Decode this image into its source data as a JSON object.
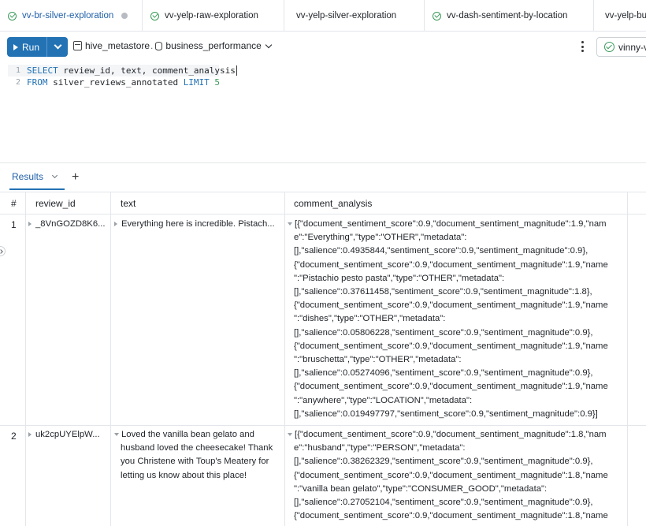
{
  "tabs": [
    {
      "label": "vv-br-silver-exploration",
      "active": true,
      "status": "check",
      "unsaved": true
    },
    {
      "label": "vv-yelp-raw-exploration",
      "active": false,
      "status": "check"
    },
    {
      "label": "vv-yelp-silver-exploration",
      "active": false,
      "status": "none"
    },
    {
      "label": "vv-dash-sentiment-by-location",
      "active": false,
      "status": "check"
    },
    {
      "label": "vv-yelp-bu",
      "active": false,
      "status": "none"
    }
  ],
  "toolbar": {
    "run_label": "Run",
    "catalog": "hive_metastore",
    "separator": ".",
    "schema": "business_performance",
    "user_label": "vinny-v"
  },
  "editor": {
    "line_numbers": [
      "1",
      "2"
    ],
    "line1": {
      "kw": "SELECT",
      "rest": " review_id, text, comment_analysis"
    },
    "line2": {
      "kw1": "FROM",
      "mid": " silver_reviews_annotated ",
      "kw2": "LIMIT",
      "num": " 5"
    }
  },
  "results": {
    "tab_label": "Results",
    "add_label": "+",
    "columns": [
      "#",
      "review_id",
      "text",
      "comment_analysis"
    ],
    "rows": [
      {
        "num": "1",
        "review_id": "_8VnGOZD8K6...",
        "text": "Everything here is incredible. Pistach...",
        "analysis_lines": [
          "[{\"document_sentiment_score\":0.9,\"document_sentiment_magnitude\":1.9,\"nam",
          "e\":\"Everything\",\"type\":\"OTHER\",\"metadata\":",
          "[],\"salience\":0.4935844,\"sentiment_score\":0.9,\"sentiment_magnitude\":0.9},",
          "{\"document_sentiment_score\":0.9,\"document_sentiment_magnitude\":1.9,\"name",
          "\":\"Pistachio pesto pasta\",\"type\":\"OTHER\",\"metadata\":",
          "[],\"salience\":0.37611458,\"sentiment_score\":0.9,\"sentiment_magnitude\":1.8},",
          "{\"document_sentiment_score\":0.9,\"document_sentiment_magnitude\":1.9,\"name",
          "\":\"dishes\",\"type\":\"OTHER\",\"metadata\":",
          "[],\"salience\":0.05806228,\"sentiment_score\":0.9,\"sentiment_magnitude\":0.9},",
          "{\"document_sentiment_score\":0.9,\"document_sentiment_magnitude\":1.9,\"name",
          "\":\"bruschetta\",\"type\":\"OTHER\",\"metadata\":",
          "[],\"salience\":0.05274096,\"sentiment_score\":0.9,\"sentiment_magnitude\":0.9},",
          "{\"document_sentiment_score\":0.9,\"document_sentiment_magnitude\":1.9,\"name",
          "\":\"anywhere\",\"type\":\"LOCATION\",\"metadata\":",
          "[],\"salience\":0.019497797,\"sentiment_score\":0.9,\"sentiment_magnitude\":0.9}]"
        ]
      },
      {
        "num": "2",
        "review_id": "uk2cpUYElpW...",
        "text_lines": [
          "Loved the vanilla bean gelato and",
          "husband loved the cheesecake! Thank",
          "you Christene with Toup's Meatery for",
          "letting us know about this place!"
        ],
        "analysis_lines": [
          "[{\"document_sentiment_score\":0.9,\"document_sentiment_magnitude\":1.8,\"nam",
          "e\":\"husband\",\"type\":\"PERSON\",\"metadata\":",
          "[],\"salience\":0.38262329,\"sentiment_score\":0.9,\"sentiment_magnitude\":0.9},",
          "{\"document_sentiment_score\":0.9,\"document_sentiment_magnitude\":1.8,\"name",
          "\":\"vanilla bean gelato\",\"type\":\"CONSUMER_GOOD\",\"metadata\":",
          "[],\"salience\":0.27052104,\"sentiment_score\":0.9,\"sentiment_magnitude\":0.9},",
          "{\"document_sentiment_score\":0.9,\"document_sentiment_magnitude\":1.8,\"name"
        ]
      }
    ]
  },
  "colors": {
    "accent": "#2272b4",
    "success": "#3a9b5b",
    "border": "#e3e6ea"
  }
}
